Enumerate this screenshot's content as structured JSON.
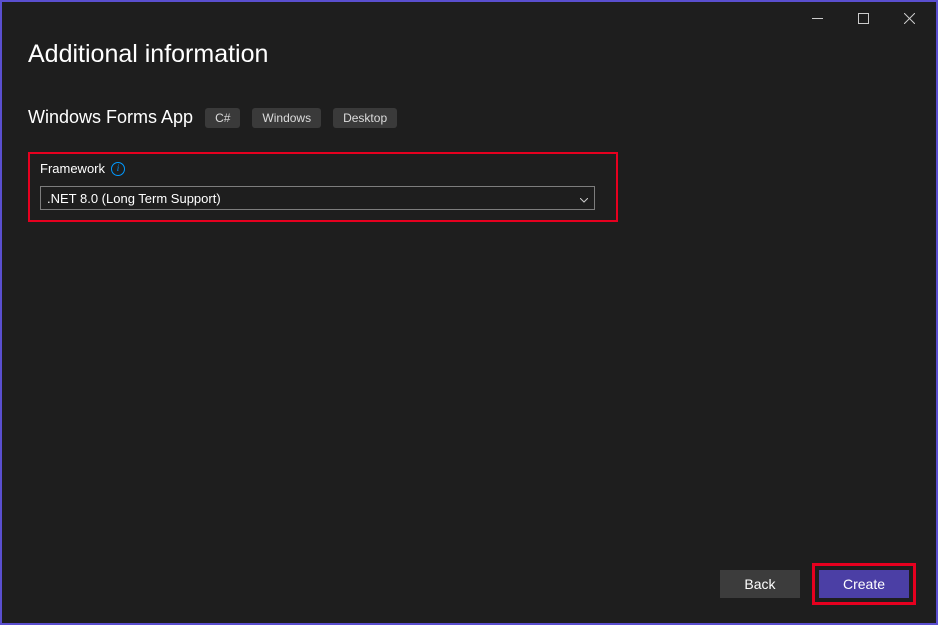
{
  "window": {
    "title": "Additional information"
  },
  "template": {
    "name": "Windows Forms App",
    "tags": [
      "C#",
      "Windows",
      "Desktop"
    ]
  },
  "framework": {
    "label": "Framework",
    "info_icon": "i",
    "selected": ".NET 8.0 (Long Term Support)"
  },
  "buttons": {
    "back": "Back",
    "create": "Create"
  },
  "highlights": {
    "framework_box": "#e6001f",
    "create_box": "#e6001f"
  },
  "colors": {
    "window_border": "#5a4fcf",
    "background": "#1e1e1e",
    "accent_button": "#4b3fa5"
  }
}
